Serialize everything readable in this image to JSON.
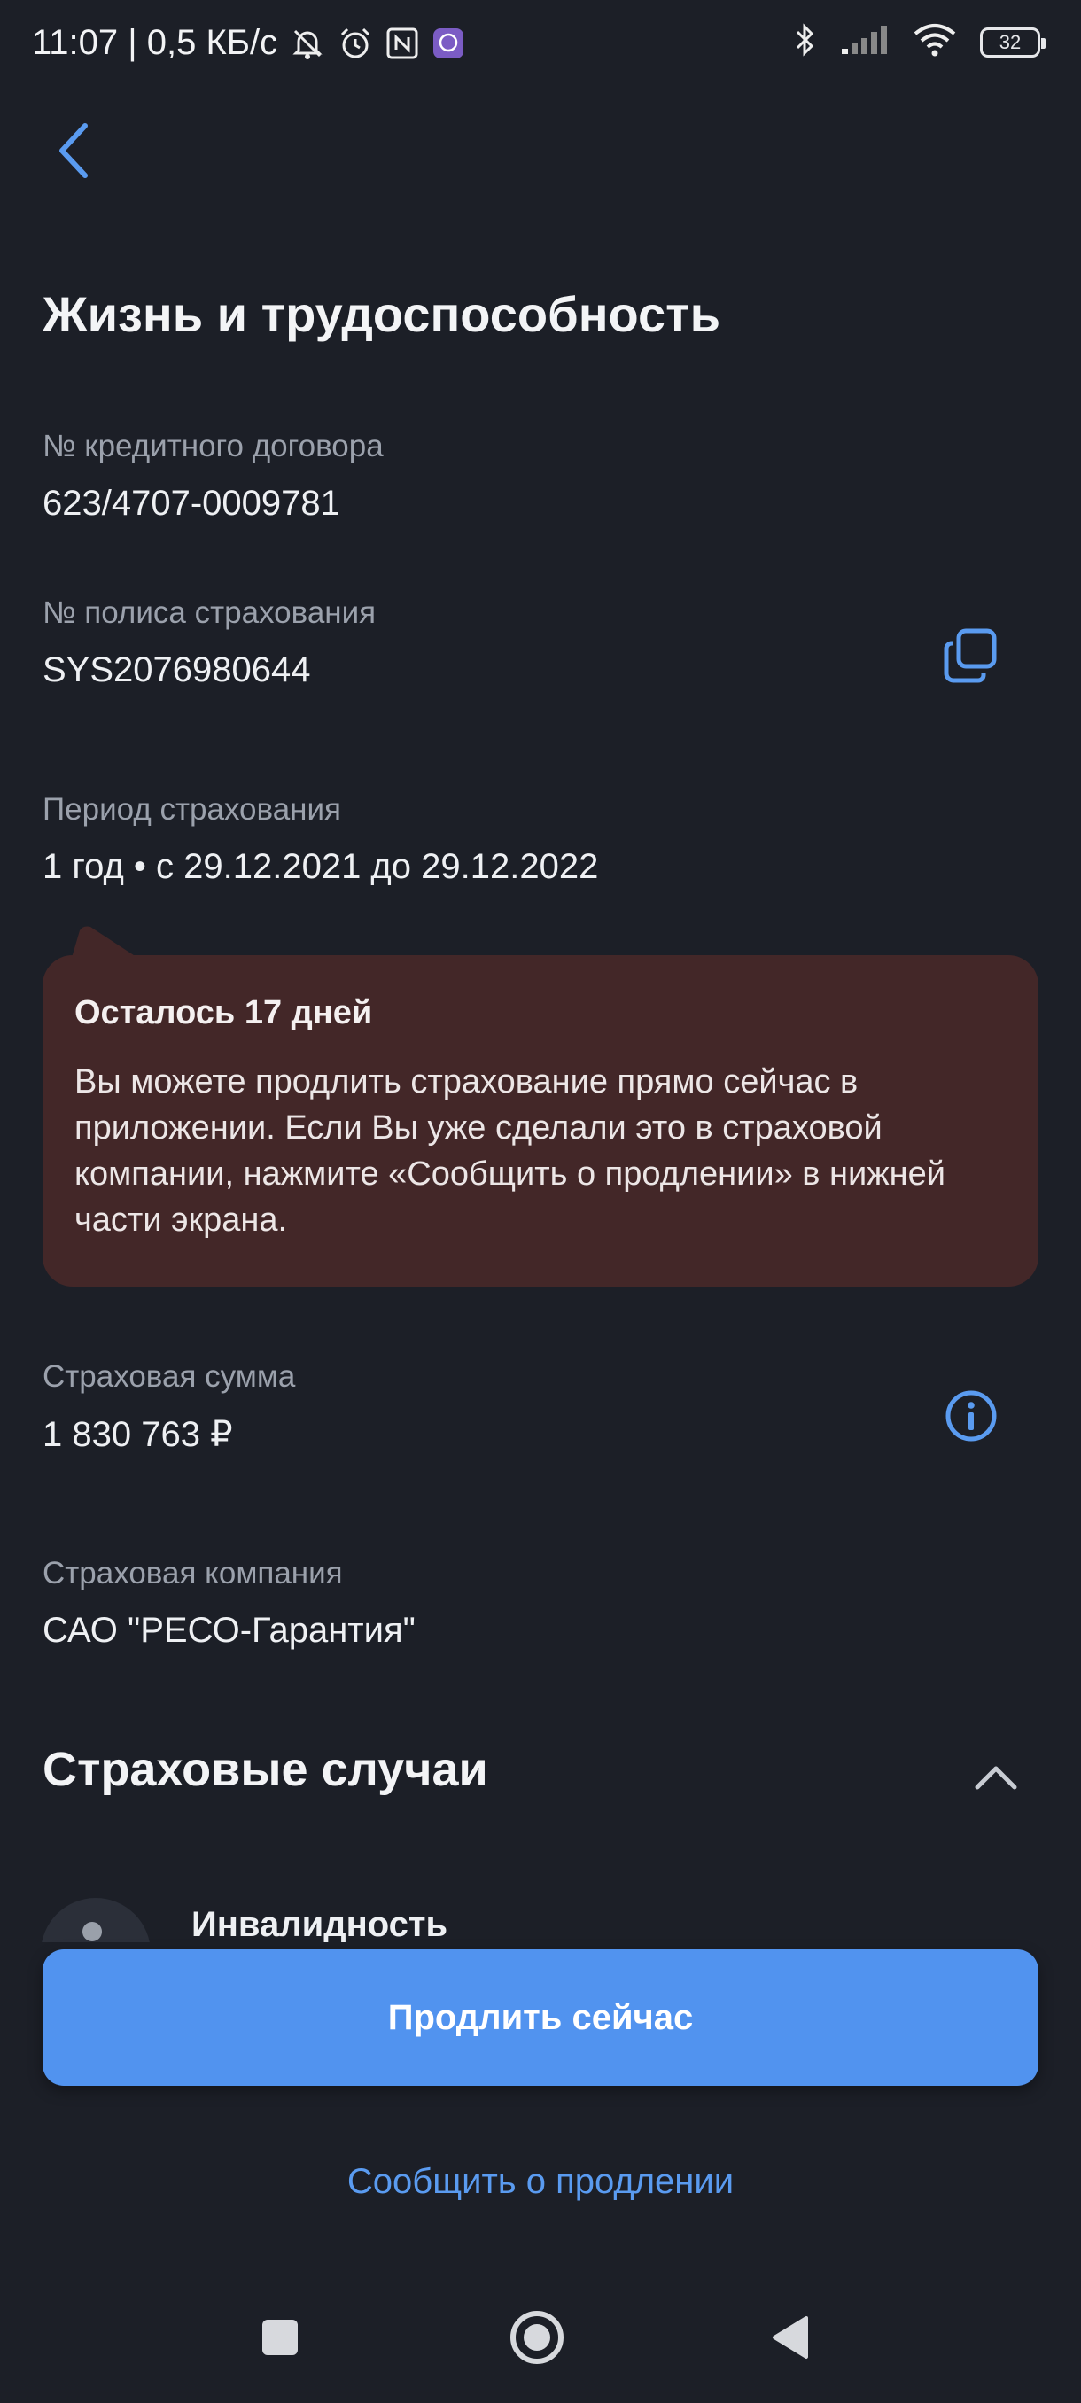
{
  "status_bar": {
    "time_speed": "11:07 | 0,5 КБ/с",
    "battery": "32",
    "icons": [
      "notifications-muted-icon",
      "alarm-icon",
      "nfc-icon",
      "viber-icon",
      "bluetooth-icon",
      "signal-icon",
      "wifi-icon",
      "battery-icon"
    ]
  },
  "header": {
    "back_icon": "chevron-left-icon",
    "title": "Жизнь и трудоспособность"
  },
  "fields": {
    "credit": {
      "label": "№ кредитного договора",
      "value": "623/4707-0009781"
    },
    "policy": {
      "label": "№ полиса страхования",
      "value": "SYS2076980644",
      "action_icon": "copy-icon"
    },
    "period": {
      "label": "Период страхования",
      "value": "1 год • с 29.12.2021 до 29.12.2022"
    },
    "sum": {
      "label": "Страховая сумма",
      "value": "1 830 763 ₽",
      "action_icon": "info-icon"
    },
    "company": {
      "label": "Страховая компания",
      "value": "САО \"РЕСО-Гарантия\""
    }
  },
  "notice": {
    "title": "Осталось 17 дней",
    "text": "Вы можете продлить страхование прямо сейчас в приложении. Если Вы уже сделали это в страховой компании, нажмите «Сообщить о продлении» в нижней части экрана."
  },
  "cases": {
    "title": "Страховые случаи",
    "items": [
      {
        "label": "Инвалидность",
        "icon": "person-icon"
      }
    ]
  },
  "actions": {
    "renew_now": "Продлить сейчас",
    "report_renewal": "Сообщить о продлении"
  },
  "nav": {
    "icons": [
      "recents-square-icon",
      "home-circle-icon",
      "back-triangle-icon"
    ]
  },
  "colors": {
    "background": "#1c1f27",
    "accent": "#5193ef",
    "notice_bg": "#432728",
    "secondary_text": "#9ba1ac"
  }
}
